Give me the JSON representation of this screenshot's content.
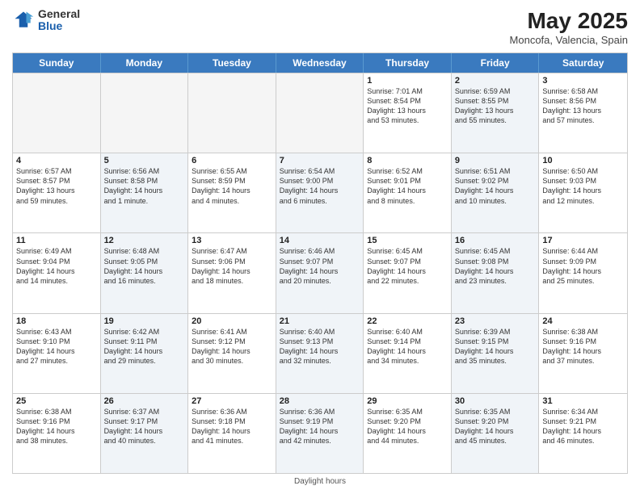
{
  "header": {
    "logo_general": "General",
    "logo_blue": "Blue",
    "month_year": "May 2025",
    "location": "Moncofa, Valencia, Spain"
  },
  "weekdays": [
    "Sunday",
    "Monday",
    "Tuesday",
    "Wednesday",
    "Thursday",
    "Friday",
    "Saturday"
  ],
  "footer": "Daylight hours",
  "weeks": [
    [
      {
        "day": "",
        "info": "",
        "empty": true
      },
      {
        "day": "",
        "info": "",
        "empty": true
      },
      {
        "day": "",
        "info": "",
        "empty": true
      },
      {
        "day": "",
        "info": "",
        "empty": true
      },
      {
        "day": "1",
        "info": "Sunrise: 7:01 AM\nSunset: 8:54 PM\nDaylight: 13 hours\nand 53 minutes."
      },
      {
        "day": "2",
        "info": "Sunrise: 6:59 AM\nSunset: 8:55 PM\nDaylight: 13 hours\nand 55 minutes.",
        "alt": true
      },
      {
        "day": "3",
        "info": "Sunrise: 6:58 AM\nSunset: 8:56 PM\nDaylight: 13 hours\nand 57 minutes."
      }
    ],
    [
      {
        "day": "4",
        "info": "Sunrise: 6:57 AM\nSunset: 8:57 PM\nDaylight: 13 hours\nand 59 minutes."
      },
      {
        "day": "5",
        "info": "Sunrise: 6:56 AM\nSunset: 8:58 PM\nDaylight: 14 hours\nand 1 minute.",
        "alt": true
      },
      {
        "day": "6",
        "info": "Sunrise: 6:55 AM\nSunset: 8:59 PM\nDaylight: 14 hours\nand 4 minutes."
      },
      {
        "day": "7",
        "info": "Sunrise: 6:54 AM\nSunset: 9:00 PM\nDaylight: 14 hours\nand 6 minutes.",
        "alt": true
      },
      {
        "day": "8",
        "info": "Sunrise: 6:52 AM\nSunset: 9:01 PM\nDaylight: 14 hours\nand 8 minutes."
      },
      {
        "day": "9",
        "info": "Sunrise: 6:51 AM\nSunset: 9:02 PM\nDaylight: 14 hours\nand 10 minutes.",
        "alt": true
      },
      {
        "day": "10",
        "info": "Sunrise: 6:50 AM\nSunset: 9:03 PM\nDaylight: 14 hours\nand 12 minutes."
      }
    ],
    [
      {
        "day": "11",
        "info": "Sunrise: 6:49 AM\nSunset: 9:04 PM\nDaylight: 14 hours\nand 14 minutes."
      },
      {
        "day": "12",
        "info": "Sunrise: 6:48 AM\nSunset: 9:05 PM\nDaylight: 14 hours\nand 16 minutes.",
        "alt": true
      },
      {
        "day": "13",
        "info": "Sunrise: 6:47 AM\nSunset: 9:06 PM\nDaylight: 14 hours\nand 18 minutes."
      },
      {
        "day": "14",
        "info": "Sunrise: 6:46 AM\nSunset: 9:07 PM\nDaylight: 14 hours\nand 20 minutes.",
        "alt": true
      },
      {
        "day": "15",
        "info": "Sunrise: 6:45 AM\nSunset: 9:07 PM\nDaylight: 14 hours\nand 22 minutes."
      },
      {
        "day": "16",
        "info": "Sunrise: 6:45 AM\nSunset: 9:08 PM\nDaylight: 14 hours\nand 23 minutes.",
        "alt": true
      },
      {
        "day": "17",
        "info": "Sunrise: 6:44 AM\nSunset: 9:09 PM\nDaylight: 14 hours\nand 25 minutes."
      }
    ],
    [
      {
        "day": "18",
        "info": "Sunrise: 6:43 AM\nSunset: 9:10 PM\nDaylight: 14 hours\nand 27 minutes."
      },
      {
        "day": "19",
        "info": "Sunrise: 6:42 AM\nSunset: 9:11 PM\nDaylight: 14 hours\nand 29 minutes.",
        "alt": true
      },
      {
        "day": "20",
        "info": "Sunrise: 6:41 AM\nSunset: 9:12 PM\nDaylight: 14 hours\nand 30 minutes."
      },
      {
        "day": "21",
        "info": "Sunrise: 6:40 AM\nSunset: 9:13 PM\nDaylight: 14 hours\nand 32 minutes.",
        "alt": true
      },
      {
        "day": "22",
        "info": "Sunrise: 6:40 AM\nSunset: 9:14 PM\nDaylight: 14 hours\nand 34 minutes."
      },
      {
        "day": "23",
        "info": "Sunrise: 6:39 AM\nSunset: 9:15 PM\nDaylight: 14 hours\nand 35 minutes.",
        "alt": true
      },
      {
        "day": "24",
        "info": "Sunrise: 6:38 AM\nSunset: 9:16 PM\nDaylight: 14 hours\nand 37 minutes."
      }
    ],
    [
      {
        "day": "25",
        "info": "Sunrise: 6:38 AM\nSunset: 9:16 PM\nDaylight: 14 hours\nand 38 minutes."
      },
      {
        "day": "26",
        "info": "Sunrise: 6:37 AM\nSunset: 9:17 PM\nDaylight: 14 hours\nand 40 minutes.",
        "alt": true
      },
      {
        "day": "27",
        "info": "Sunrise: 6:36 AM\nSunset: 9:18 PM\nDaylight: 14 hours\nand 41 minutes."
      },
      {
        "day": "28",
        "info": "Sunrise: 6:36 AM\nSunset: 9:19 PM\nDaylight: 14 hours\nand 42 minutes.",
        "alt": true
      },
      {
        "day": "29",
        "info": "Sunrise: 6:35 AM\nSunset: 9:20 PM\nDaylight: 14 hours\nand 44 minutes."
      },
      {
        "day": "30",
        "info": "Sunrise: 6:35 AM\nSunset: 9:20 PM\nDaylight: 14 hours\nand 45 minutes.",
        "alt": true
      },
      {
        "day": "31",
        "info": "Sunrise: 6:34 AM\nSunset: 9:21 PM\nDaylight: 14 hours\nand 46 minutes."
      }
    ]
  ]
}
